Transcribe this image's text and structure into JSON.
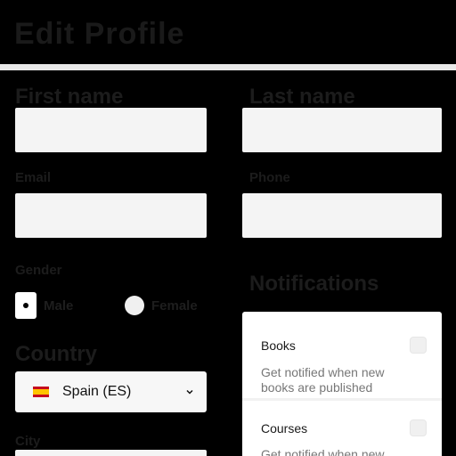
{
  "header": {
    "title": "Edit Profile"
  },
  "form": {
    "first_name_label": "First name",
    "last_name_label": "Last name",
    "email_label": "Email",
    "phone_label": "Phone",
    "gender_label": "Gender",
    "gender_options": [
      "Male",
      "Female"
    ],
    "gender_selected": "Male",
    "country_label": "Country",
    "country_value": "Spain (ES)",
    "city_label": "City"
  },
  "notifications": {
    "heading": "Notifications",
    "items": [
      {
        "title": "Books",
        "description": "Get notified when new books are published",
        "checked": false
      },
      {
        "title": "Courses",
        "description": "Get notified when new courses are published",
        "checked": false
      }
    ]
  },
  "colors": {
    "flag_red": "#c60b1e",
    "flag_yellow": "#ffc400"
  }
}
